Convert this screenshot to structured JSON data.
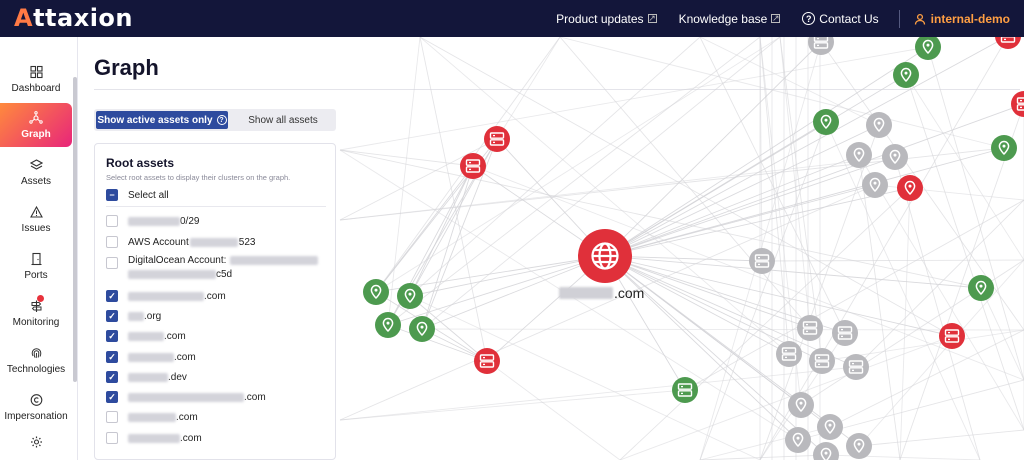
{
  "brand": {
    "logo_text_a": "A",
    "logo_text_rest": "ttaxion"
  },
  "topnav": {
    "product_updates": "Product updates",
    "knowledge_base": "Knowledge base",
    "contact_us": "Contact Us",
    "user": "internal-demo"
  },
  "sidebar": {
    "items": [
      {
        "label": "Dashboard",
        "icon": "grid-icon"
      },
      {
        "label": "Graph",
        "icon": "graph-icon",
        "active": true
      },
      {
        "label": "Assets",
        "icon": "layers-icon"
      },
      {
        "label": "Issues",
        "icon": "warning-icon"
      },
      {
        "label": "Ports",
        "icon": "door-icon"
      },
      {
        "label": "Monitoring",
        "icon": "signpost-icon"
      },
      {
        "label": "Technologies",
        "icon": "fingerprint-icon"
      },
      {
        "label": "Impersonation",
        "icon": "copyright-icon"
      },
      {
        "label": "",
        "icon": "gear-icon"
      }
    ]
  },
  "page": {
    "title": "Graph"
  },
  "toggle": {
    "active_label": "Show active assets only",
    "all_label": "Show all assets"
  },
  "root_assets": {
    "title": "Root assets",
    "subtitle": "Select root assets to display their clusters on the graph.",
    "select_all": "Select all",
    "items": [
      {
        "text": "0/29",
        "checked": false
      },
      {
        "text_prefix": "AWS Account",
        "text": "523",
        "checked": false
      },
      {
        "text_prefix": "DigitalOcean Account:",
        "text": "c5d",
        "checked": false
      },
      {
        "text": ".com",
        "checked": true
      },
      {
        "text": ".org",
        "checked": true
      },
      {
        "text": ".com",
        "checked": true
      },
      {
        "text": ".com",
        "checked": true
      },
      {
        "text": ".dev",
        "checked": true
      },
      {
        "text": ".com",
        "checked": true
      },
      {
        "text": ".com",
        "checked": false
      },
      {
        "text": ".com",
        "checked": false
      }
    ]
  },
  "graph": {
    "center_label": ".com",
    "colors": {
      "red": "#e0303a",
      "green": "#4d9a4f",
      "grey": "#b9b9bd",
      "edge": "#d4d4d8"
    }
  }
}
